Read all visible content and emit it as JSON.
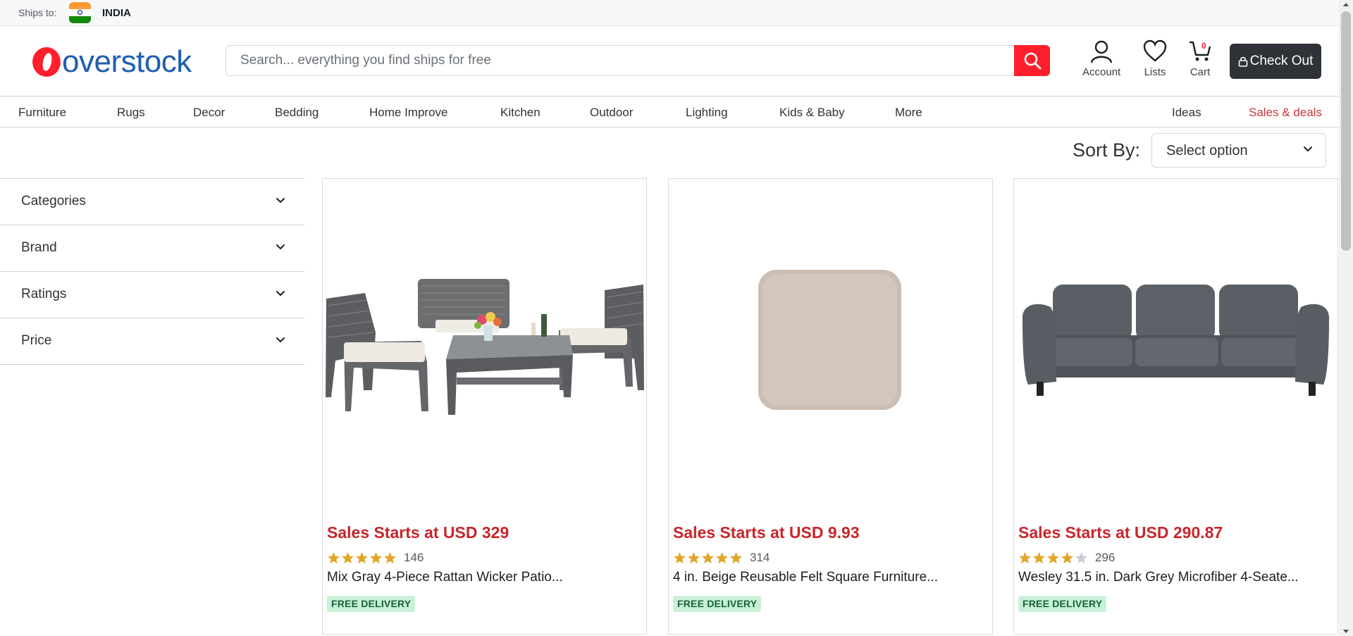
{
  "shipbar": {
    "label": "Ships to:",
    "country": "INDIA",
    "flag_icon": "india-flag-icon"
  },
  "header": {
    "logo_text": "overstock",
    "search": {
      "placeholder": "Search... everything you find ships for free",
      "value": ""
    },
    "account_label": "Account",
    "lists_label": "Lists",
    "cart_label": "Cart",
    "cart_count": "0",
    "checkout_label": "Check Out"
  },
  "nav": {
    "items": [
      "Furniture",
      "Rugs",
      "Decor",
      "Bedding",
      "Home Improve",
      "Kitchen",
      "Outdoor",
      "Lighting",
      "Kids & Baby",
      "More"
    ],
    "ideas": "Ideas",
    "sales": "Sales & deals"
  },
  "sort": {
    "label": "Sort By:",
    "selected": "Select option"
  },
  "filters": [
    "Categories",
    "Brand",
    "Ratings",
    "Price"
  ],
  "products": [
    {
      "price": "Sales Starts at USD 329",
      "rating": 5,
      "review_count": "146",
      "name": "Mix Gray 4-Piece Rattan Wicker Patio...",
      "badge": "FREE DELIVERY"
    },
    {
      "price": "Sales Starts at USD 9.93",
      "rating": 5,
      "review_count": "314",
      "name": "4 in. Beige Reusable Felt Square Furniture...",
      "badge": "FREE DELIVERY"
    },
    {
      "price": "Sales Starts at USD 290.87",
      "rating": 4,
      "review_count": "296",
      "name": "Wesley 31.5 in. Dark Grey Microfiber 4-Seate...",
      "badge": "FREE DELIVERY"
    }
  ],
  "colors": {
    "brand_red": "#ff1f2c",
    "brand_blue": "#1f5eaf",
    "price_red": "#c8262b",
    "star_gold": "#e1a629",
    "badge_green": "#c8f0d6"
  }
}
